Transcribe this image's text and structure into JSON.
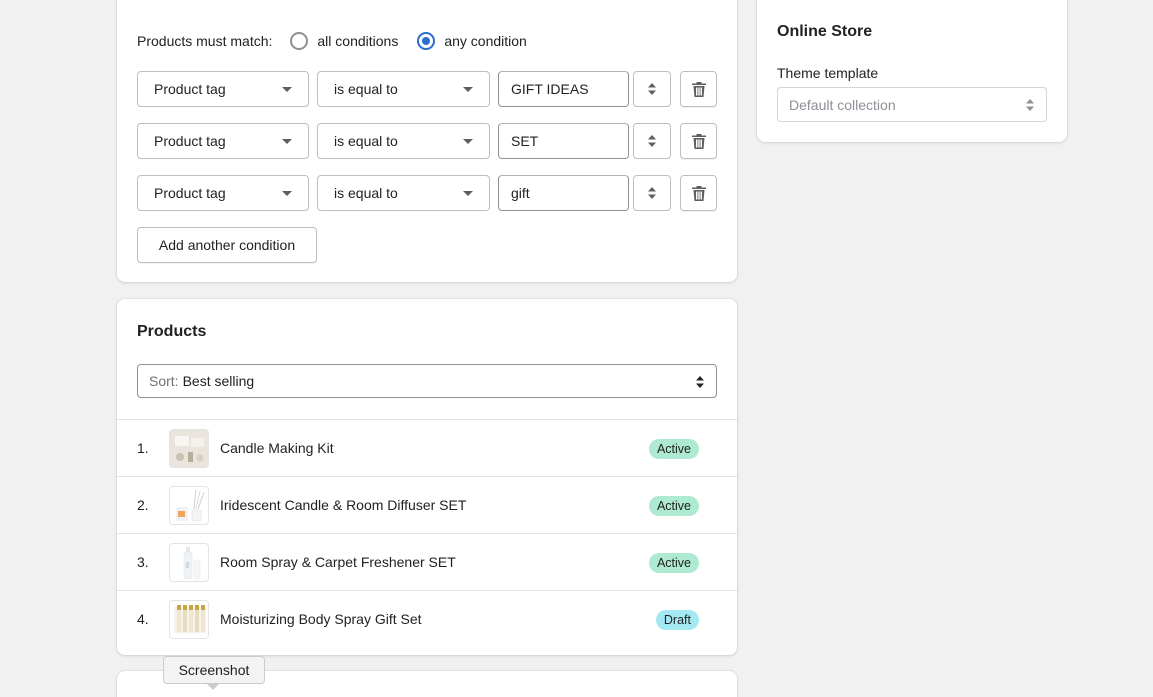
{
  "conditions": {
    "match_label": "Products must match:",
    "options": [
      {
        "label": "all conditions",
        "checked": false
      },
      {
        "label": "any condition",
        "checked": true
      }
    ],
    "rows": [
      {
        "column": "Product tag",
        "relation": "is equal to",
        "value": "GIFT IDEAS"
      },
      {
        "column": "Product tag",
        "relation": "is equal to",
        "value": "SET"
      },
      {
        "column": "Product tag",
        "relation": "is equal to",
        "value": "gift"
      }
    ],
    "add_button": "Add another condition"
  },
  "products": {
    "title": "Products",
    "sort_prefix": "Sort:",
    "sort_value": "Best selling",
    "items": [
      {
        "index": "1.",
        "name": "Candle Making Kit",
        "status": "Active"
      },
      {
        "index": "2.",
        "name": "Iridescent Candle & Room Diffuser SET",
        "status": "Active"
      },
      {
        "index": "3.",
        "name": "Room Spray & Carpet Freshener SET",
        "status": "Active"
      },
      {
        "index": "4.",
        "name": "Moisturizing Body Spray Gift Set",
        "status": "Draft"
      }
    ]
  },
  "online_store": {
    "title": "Online Store",
    "theme_label": "Theme template",
    "theme_value": "Default collection"
  },
  "tooltip": "Screenshot",
  "colors": {
    "accent": "#2c6ecb",
    "active_badge": "#aee9d1",
    "draft_badge": "#a4e8f2"
  }
}
